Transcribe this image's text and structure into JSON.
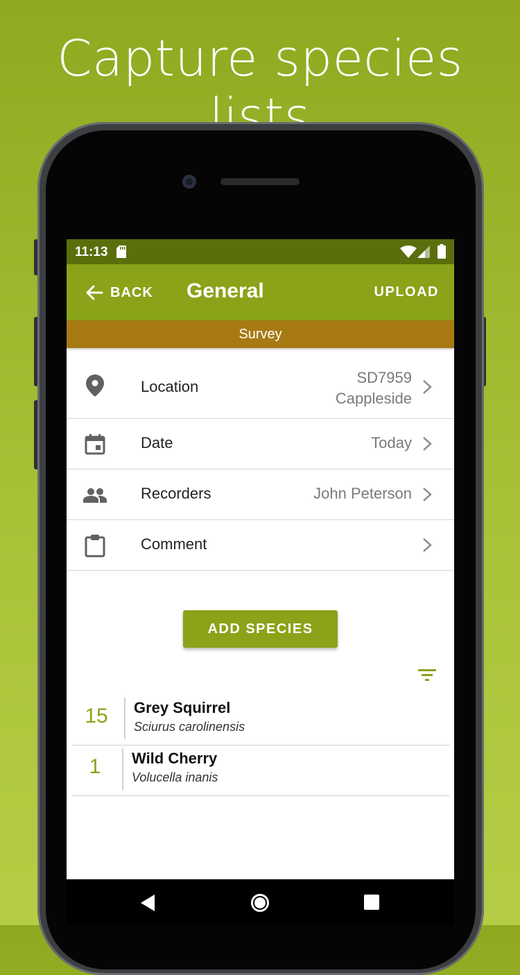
{
  "headline": "Capture species lists",
  "status_bar": {
    "time": "11:13"
  },
  "app_bar": {
    "back_label": "BACK",
    "title": "General",
    "upload_label": "UPLOAD"
  },
  "survey_label": "Survey",
  "fields": {
    "location": {
      "label": "Location",
      "value_line1": "SD7959",
      "value_line2": "Cappleside",
      "icon": "map-marker-icon"
    },
    "date": {
      "label": "Date",
      "value": "Today",
      "icon": "calendar-icon"
    },
    "recorders": {
      "label": "Recorders",
      "value": "John Peterson",
      "icon": "people-icon"
    },
    "comment": {
      "label": "Comment",
      "value": "",
      "icon": "clipboard-icon"
    }
  },
  "add_species_label": "ADD SPECIES",
  "species": [
    {
      "count": "15",
      "common_name": "Grey Squirrel",
      "latin_name": "Sciurus carolinensis"
    },
    {
      "count": "1",
      "common_name": "Wild Cherry",
      "latin_name": "Volucella inanis"
    }
  ],
  "colors": {
    "background": "#9ab52a",
    "app_bar": "#8aa318",
    "status_bar": "#5b6e0c",
    "survey_bar": "#a87a14",
    "accent": "#8aa318"
  }
}
